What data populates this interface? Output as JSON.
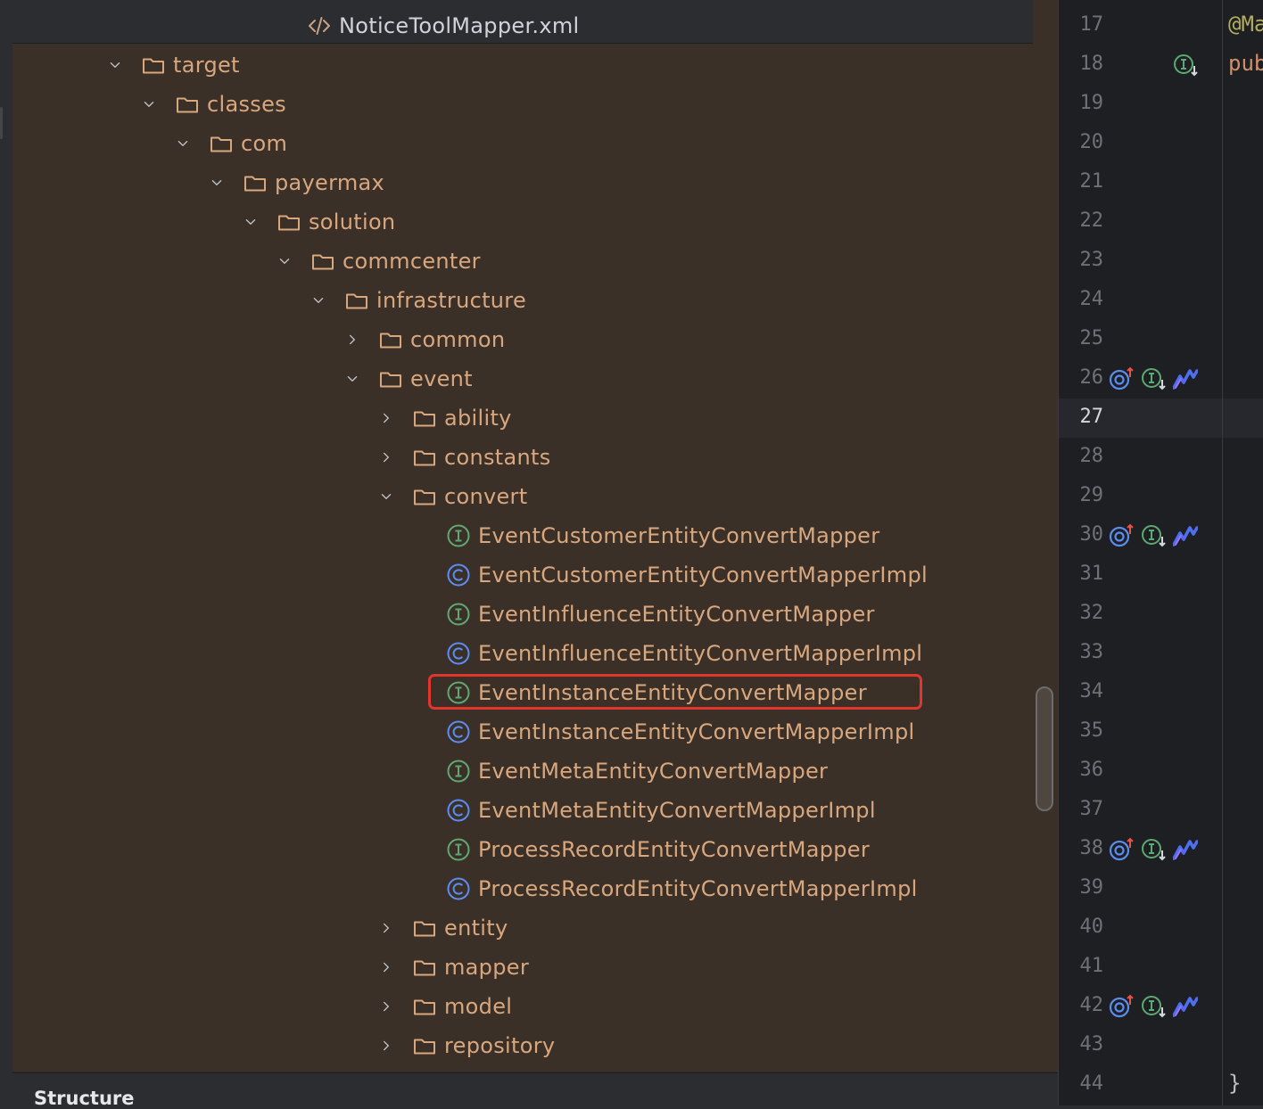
{
  "project_tree": {
    "header_file": {
      "label": "NoticeToolMapper.xml",
      "icon": "xml-file-icon"
    },
    "rows": [
      {
        "label": "target",
        "type": "folder",
        "expanded": true,
        "depth": 0
      },
      {
        "label": "classes",
        "type": "folder",
        "expanded": true,
        "depth": 1
      },
      {
        "label": "com",
        "type": "folder",
        "expanded": true,
        "depth": 2
      },
      {
        "label": "payermax",
        "type": "folder",
        "expanded": true,
        "depth": 3
      },
      {
        "label": "solution",
        "type": "folder",
        "expanded": true,
        "depth": 4
      },
      {
        "label": "commcenter",
        "type": "folder",
        "expanded": true,
        "depth": 5
      },
      {
        "label": "infrastructure",
        "type": "folder",
        "expanded": true,
        "depth": 6
      },
      {
        "label": "common",
        "type": "folder",
        "expanded": false,
        "depth": 7
      },
      {
        "label": "event",
        "type": "folder",
        "expanded": true,
        "depth": 7
      },
      {
        "label": "ability",
        "type": "folder",
        "expanded": false,
        "depth": 8
      },
      {
        "label": "constants",
        "type": "folder",
        "expanded": false,
        "depth": 8
      },
      {
        "label": "convert",
        "type": "folder",
        "expanded": true,
        "depth": 8
      },
      {
        "label": "EventCustomerEntityConvertMapper",
        "type": "interface",
        "depth": 9
      },
      {
        "label": "EventCustomerEntityConvertMapperImpl",
        "type": "class",
        "depth": 9
      },
      {
        "label": "EventInfluenceEntityConvertMapper",
        "type": "interface",
        "depth": 9
      },
      {
        "label": "EventInfluenceEntityConvertMapperImpl",
        "type": "class",
        "depth": 9
      },
      {
        "label": "EventInstanceEntityConvertMapper",
        "type": "interface",
        "depth": 9,
        "highlighted": true
      },
      {
        "label": "EventInstanceEntityConvertMapperImpl",
        "type": "class",
        "depth": 9
      },
      {
        "label": "EventMetaEntityConvertMapper",
        "type": "interface",
        "depth": 9
      },
      {
        "label": "EventMetaEntityConvertMapperImpl",
        "type": "class",
        "depth": 9
      },
      {
        "label": "ProcessRecordEntityConvertMapper",
        "type": "interface",
        "depth": 9
      },
      {
        "label": "ProcessRecordEntityConvertMapperImpl",
        "type": "class",
        "depth": 9
      },
      {
        "label": "entity",
        "type": "folder",
        "expanded": false,
        "depth": 8
      },
      {
        "label": "mapper",
        "type": "folder",
        "expanded": false,
        "depth": 8
      },
      {
        "label": "model",
        "type": "folder",
        "expanded": false,
        "depth": 8
      },
      {
        "label": "repository",
        "type": "folder",
        "expanded": false,
        "depth": 8
      }
    ]
  },
  "bottom_panel": {
    "title": "Structure"
  },
  "gutter": {
    "current_line": "27",
    "lines": [
      {
        "num": "17",
        "icons": []
      },
      {
        "num": "18",
        "icons": [
          "interface-implemented-icon"
        ]
      },
      {
        "num": "19",
        "icons": []
      },
      {
        "num": "20",
        "icons": []
      },
      {
        "num": "21",
        "icons": []
      },
      {
        "num": "22",
        "icons": []
      },
      {
        "num": "23",
        "icons": []
      },
      {
        "num": "24",
        "icons": []
      },
      {
        "num": "25",
        "icons": []
      },
      {
        "num": "26",
        "icons": [
          "overrides-up-icon",
          "implemented-down-icon",
          "mybatis-icon"
        ]
      },
      {
        "num": "27",
        "icons": []
      },
      {
        "num": "28",
        "icons": []
      },
      {
        "num": "29",
        "icons": []
      },
      {
        "num": "30",
        "icons": [
          "overrides-up-icon",
          "implemented-down-icon",
          "mybatis-icon"
        ]
      },
      {
        "num": "31",
        "icons": []
      },
      {
        "num": "32",
        "icons": []
      },
      {
        "num": "33",
        "icons": []
      },
      {
        "num": "34",
        "icons": []
      },
      {
        "num": "35",
        "icons": []
      },
      {
        "num": "36",
        "icons": []
      },
      {
        "num": "37",
        "icons": []
      },
      {
        "num": "38",
        "icons": [
          "overrides-up-icon",
          "implemented-down-icon",
          "mybatis-icon"
        ]
      },
      {
        "num": "39",
        "icons": []
      },
      {
        "num": "40",
        "icons": []
      },
      {
        "num": "41",
        "icons": []
      },
      {
        "num": "42",
        "icons": [
          "overrides-up-icon",
          "implemented-down-icon",
          "mybatis-icon"
        ]
      },
      {
        "num": "43",
        "icons": []
      },
      {
        "num": "44",
        "icons": []
      }
    ]
  },
  "editor": {
    "code_fragments": [
      {
        "line": "17",
        "text": "@Ma",
        "color": "#b3ae60"
      },
      {
        "line": "18",
        "text": "pub",
        "color": "#cf8e6d"
      },
      {
        "line": "44",
        "text": "}",
        "color": "#bcbec4"
      }
    ]
  },
  "colors": {
    "tree_background": "#3a3028",
    "folder_text": "#d9a77e",
    "highlight_border": "#e0362c",
    "interface_icon": "#5fa872",
    "class_icon": "#5b8def"
  }
}
